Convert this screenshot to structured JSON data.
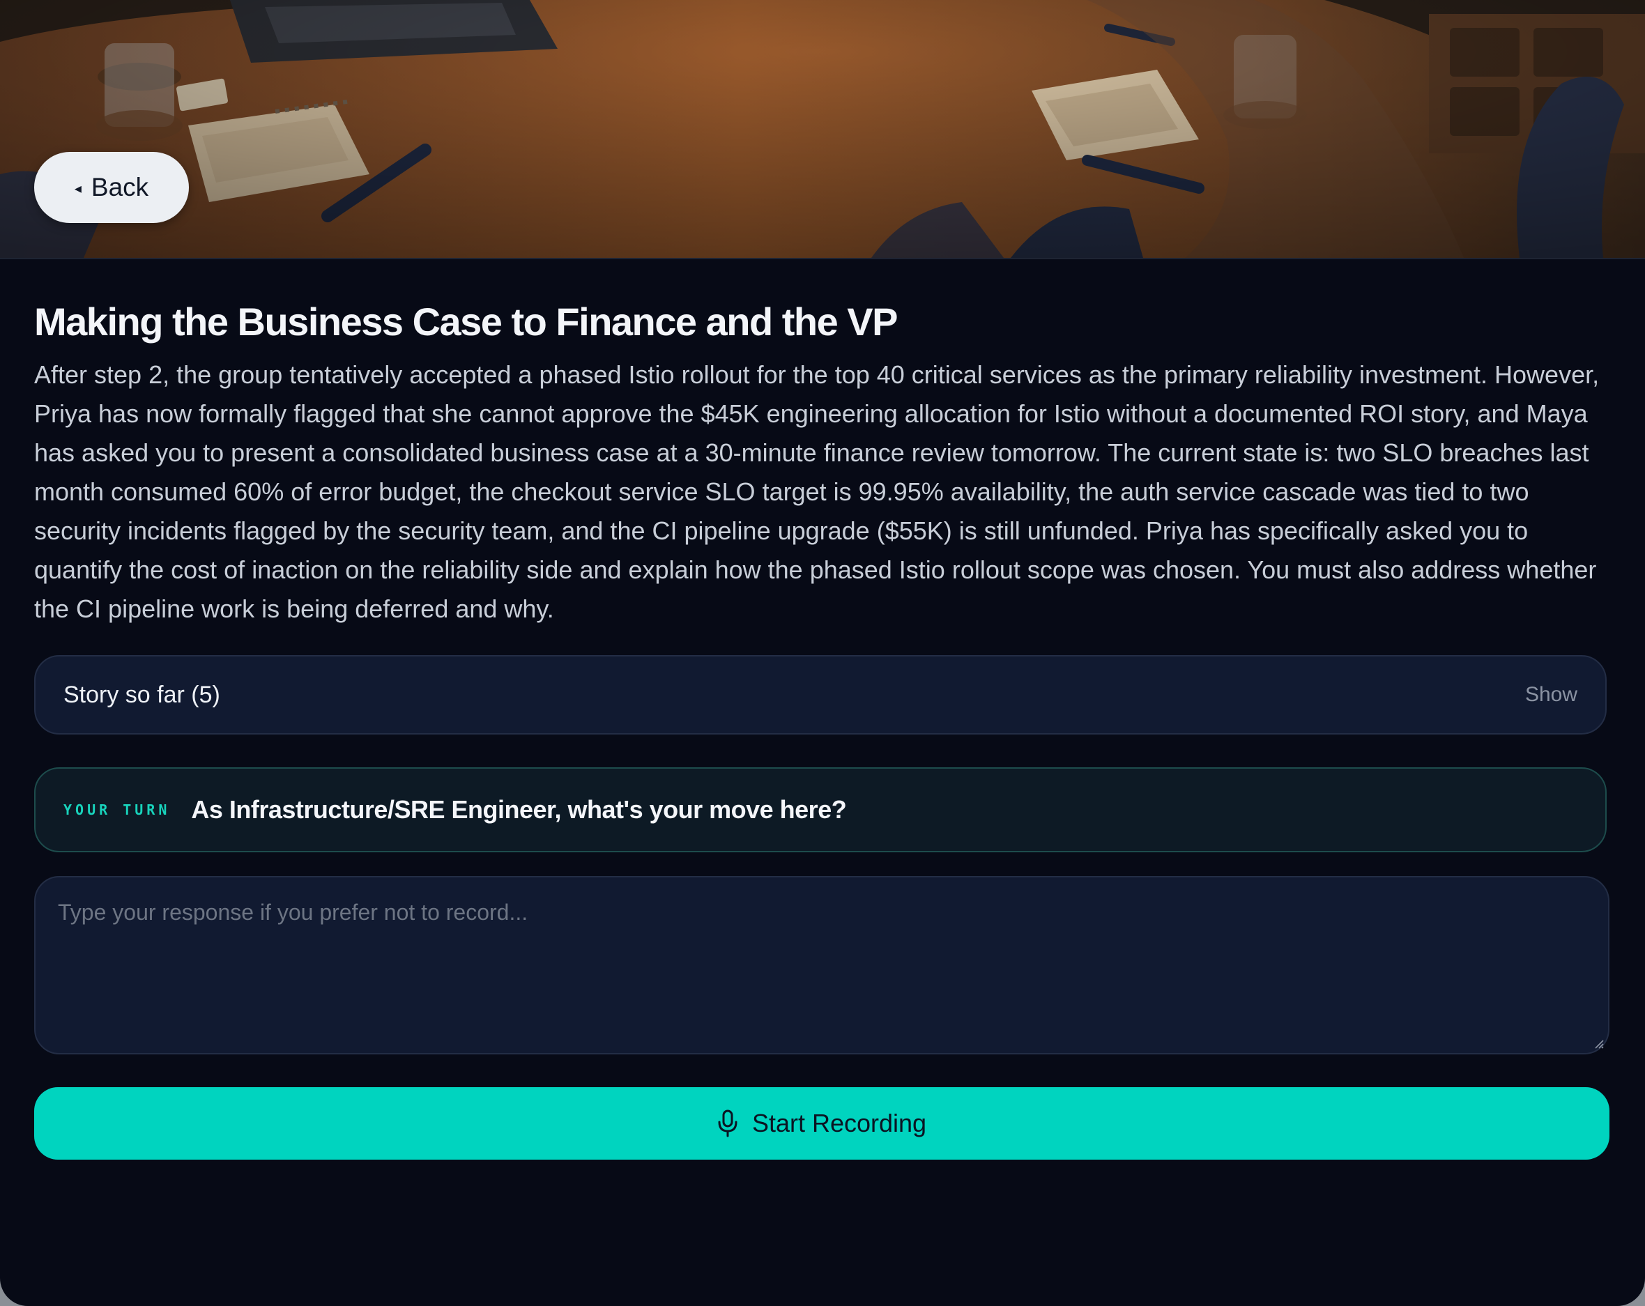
{
  "hero": {
    "illustration": "office-desk-scene"
  },
  "nav": {
    "back_label": "Back",
    "back_icon": "caret-left-icon"
  },
  "scenario": {
    "title": "Making the Business Case to Finance and the VP",
    "description": "After step 2, the group tentatively accepted a phased Istio rollout for the top 40 critical services as the primary reliability investment. However, Priya has now formally flagged that she cannot approve the $45K engineering allocation for Istio without a documented ROI story, and Maya has asked you to present a consolidated business case at a 30-minute finance review tomorrow. The current state is: two SLO breaches last month consumed 60% of error budget, the checkout service SLO target is 99.95% availability, the auth service cascade was tied to two security incidents flagged by the security team, and the CI pipeline upgrade ($55K) is still unfunded. Priya has specifically asked you to quantify the cost of inaction on the reliability side and explain how the phased Istio rollout scope was chosen. You must also address whether the CI pipeline work is being deferred and why."
  },
  "story": {
    "label": "Story so far (5)",
    "toggle_label": "Show"
  },
  "turn": {
    "tag": "YOUR TURN",
    "prompt": "As Infrastructure/SRE Engineer, what's your move here?"
  },
  "response": {
    "placeholder": "Type your response if you prefer not to record...",
    "value": ""
  },
  "record": {
    "label": "Start Recording",
    "icon": "microphone-icon"
  },
  "colors": {
    "background": "#070a16",
    "panel": "#111a31",
    "accent": "#00d4bf",
    "accent_text": "#18d3bc"
  }
}
